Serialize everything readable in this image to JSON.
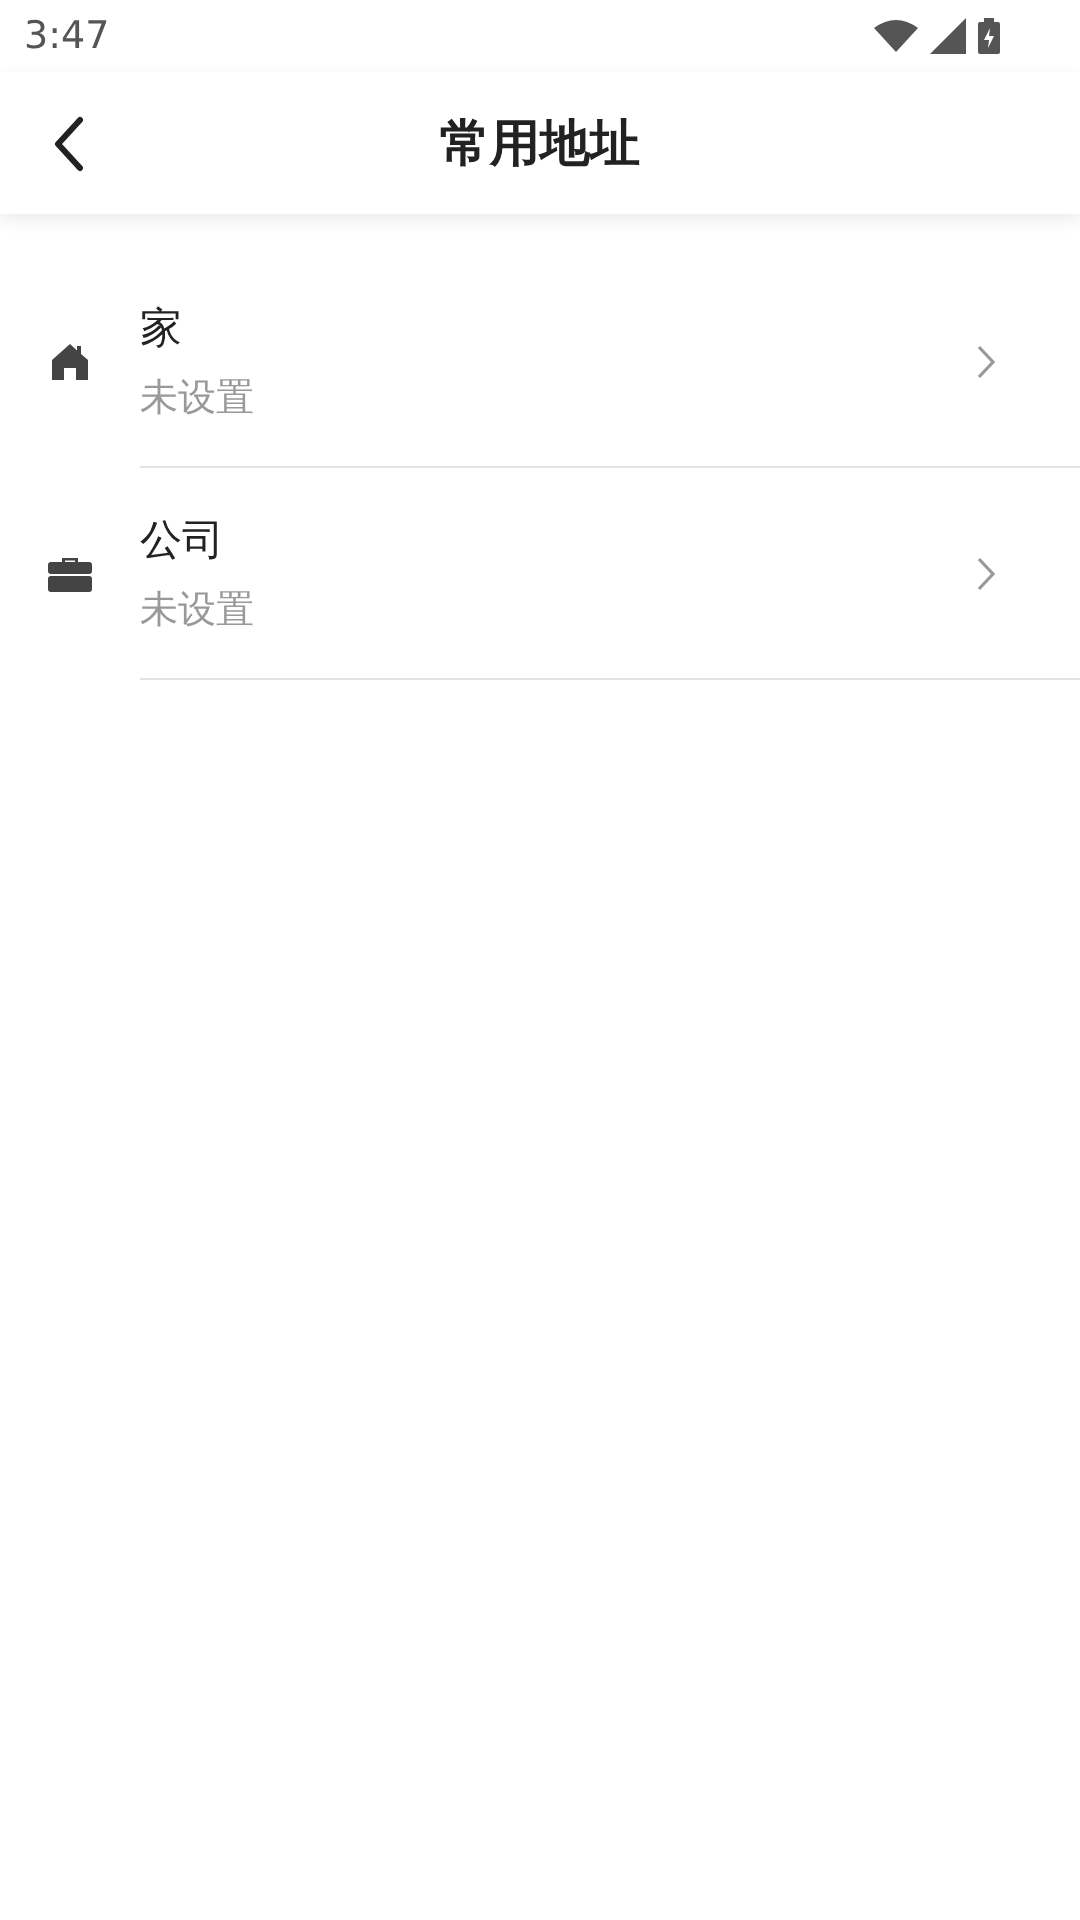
{
  "status_bar": {
    "time": "3:47"
  },
  "header": {
    "title": "常用地址"
  },
  "addresses": [
    {
      "kind": "home",
      "title": "家",
      "subtitle": "未设置"
    },
    {
      "kind": "work",
      "title": "公司",
      "subtitle": "未设置"
    }
  ]
}
